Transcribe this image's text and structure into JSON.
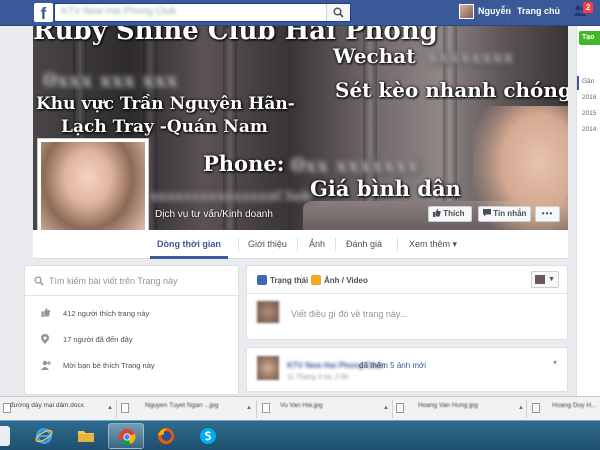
{
  "topbar": {
    "logo": "f",
    "search_text": "KTV New Hai Phong Club",
    "user_name": "Nguyễn",
    "home_label": "Trang chủ",
    "friend_badge": "2"
  },
  "cover": {
    "title": "Ruby Shine Club Hải Phòng",
    "wechat_label": "Wechat",
    "wechat_id": "xxxxxxxx",
    "blurred_line": "0xxx xxx xxx",
    "region_line1": "Khu vực Trần Nguyên Hãn-",
    "region_line2": "Lạch Tray -Quán Nam",
    "deal_text": "Sét kèo nhanh chóng",
    "phone_label": "Phone:",
    "phone_number": "0xx xxxxxxx",
    "price_text": "Giá bình dân",
    "blurred_line2": "xxxxxxxxxxxxxxxClub",
    "category": "Dịch vụ tư vấn/Kinh doanh"
  },
  "buttons": {
    "like": "Thích",
    "message": "Tin nhắn",
    "more": "•••"
  },
  "tabs": [
    {
      "label": "Dòng thời gian"
    },
    {
      "label": "Giới thiệu"
    },
    {
      "label": "Ảnh"
    },
    {
      "label": "Đánh giá"
    },
    {
      "label": "Xem thêm ▾"
    }
  ],
  "left": {
    "search_placeholder": "Tìm kiếm bài viết trên Trang này",
    "rows": [
      {
        "text": "412 người thích trang này"
      },
      {
        "text": "17 người đã đến đây"
      },
      {
        "text": "Mời bạn bè thích Trang này"
      }
    ]
  },
  "composer": {
    "tab_status": "Trạng thái",
    "tab_photo": "Ảnh / Video",
    "placeholder": "Viết điều gì đó về trang này..."
  },
  "post": {
    "author": "KTV New Hai Phong Club",
    "action_prefix": "đã thêm",
    "action_link": "5 ảnh mới",
    "time": "11 Tháng 3 lúc 2:56",
    "chevron": "▾"
  },
  "right_rail": {
    "create_label": "Tạo",
    "items": [
      "Gần",
      "2016",
      "2015",
      "2014"
    ]
  },
  "downloads": [
    {
      "name": "đường dây mại dâm.docx"
    },
    {
      "name": "Nguyen Tuyet Ngan ...jpg"
    },
    {
      "name": "Vu Van Hai.jpg"
    },
    {
      "name": "Hoang Van Hung.jpg"
    },
    {
      "name": "Hoang Duy H..."
    }
  ],
  "taskbar": {
    "apps": [
      "windows-explorer",
      "internet-explorer",
      "file-explorer",
      "chrome",
      "firefox",
      "skype"
    ]
  }
}
